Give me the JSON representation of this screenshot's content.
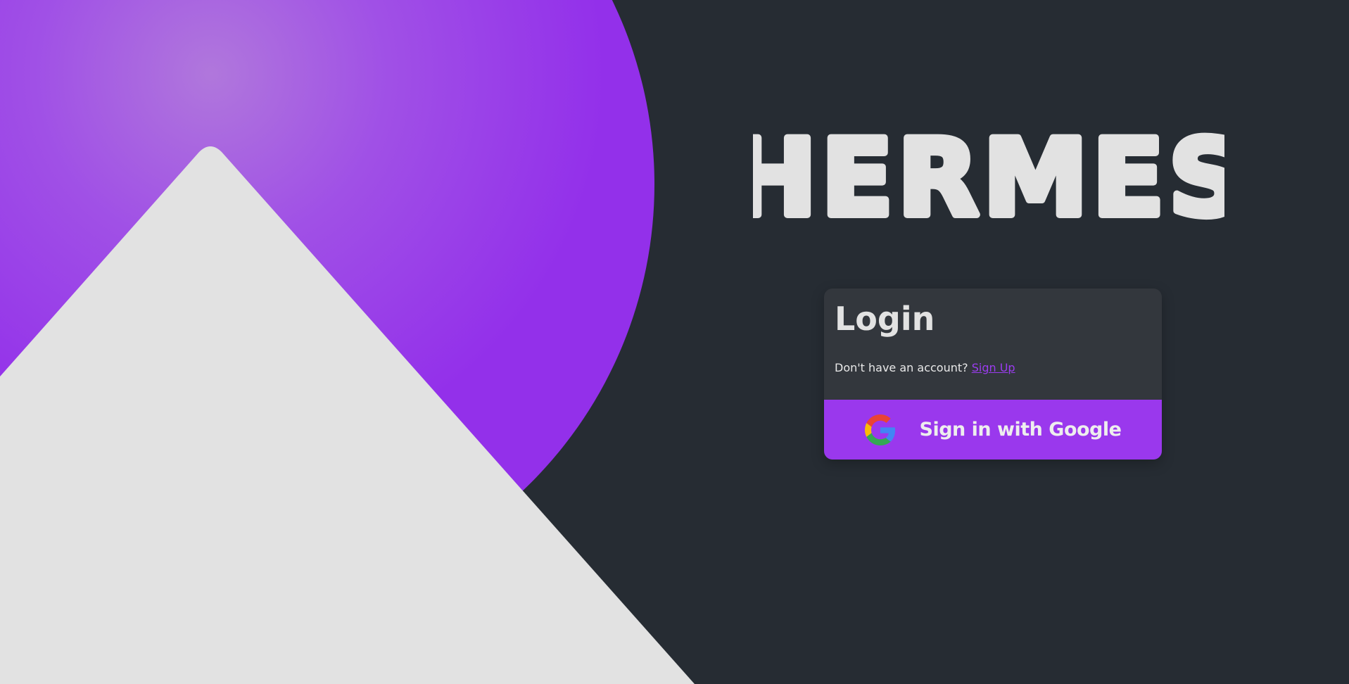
{
  "app": {
    "brand": "HERMES"
  },
  "login": {
    "title": "Login",
    "no_account_text": "Don't have an account?",
    "signup_link": "Sign Up",
    "google_button_label": "Sign in with Google",
    "google_icon": "google-g-icon"
  },
  "colors": {
    "background": "#262c33",
    "card": "#33373d",
    "accent": "#9a38ed",
    "circle": "#9330ea",
    "mountain": "#e2e2e2",
    "text": "#e2e2e2"
  }
}
